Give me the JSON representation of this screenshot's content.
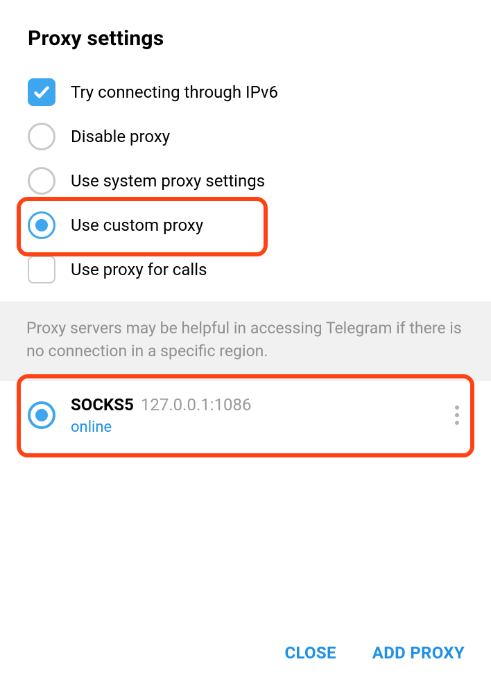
{
  "title": "Proxy settings",
  "options": {
    "ipv6": {
      "label": "Try connecting through IPv6",
      "type": "checkbox",
      "checked": true
    },
    "disable": {
      "label": "Disable proxy",
      "type": "radio",
      "selected": false
    },
    "system": {
      "label": "Use system proxy settings",
      "type": "radio",
      "selected": false
    },
    "custom": {
      "label": "Use custom proxy",
      "type": "radio",
      "selected": true
    },
    "calls": {
      "label": "Use proxy for calls",
      "type": "checkbox",
      "checked": false
    }
  },
  "info_text": "Proxy servers may be helpful in accessing Telegram if there is no connection in a specific region.",
  "proxies": [
    {
      "type": "SOCKS5",
      "address": "127.0.0.1:1086",
      "status": "online",
      "selected": true
    }
  ],
  "footer": {
    "close": "CLOSE",
    "add_proxy": "ADD PROXY"
  },
  "colors": {
    "accent": "#3ea5ef",
    "link": "#1e90e5",
    "muted": "#9a9a9a",
    "annotation": "#ff4215",
    "info_bg": "#f1f1f1"
  },
  "highlighted": [
    "custom",
    "proxies.0"
  ]
}
